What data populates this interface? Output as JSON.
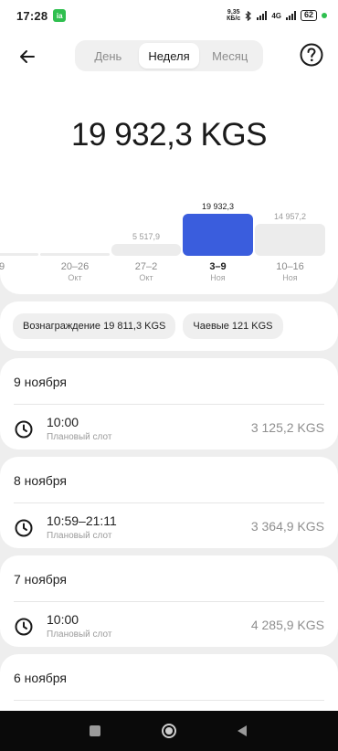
{
  "status_bar": {
    "time": "17:28",
    "app_badge": "ia",
    "speed_top": "9,35",
    "speed_bottom": "КБ/с",
    "network": "4G",
    "battery": "62"
  },
  "header": {
    "tabs": [
      {
        "label": "День",
        "active": false
      },
      {
        "label": "Неделя",
        "active": true
      },
      {
        "label": "Месяц",
        "active": false
      }
    ]
  },
  "total": "19 932,3 KGS",
  "chart_data": {
    "type": "bar",
    "categories": [
      "9",
      "20–26",
      "27–2",
      "3–9",
      "10–16"
    ],
    "sublabels": [
      "",
      "Окт",
      "Окт",
      "Ноя",
      "Ноя"
    ],
    "value_labels": [
      "",
      "",
      "5 517,9",
      "19 932,3",
      "14 957,2"
    ],
    "values": [
      null,
      null,
      5517.9,
      19932.3,
      14957.2
    ],
    "selected_index": 3,
    "colors": {
      "selected": "#3a5ddd",
      "default": "#ececec"
    }
  },
  "chips": [
    {
      "label": "Вознаграждение 19 811,3 KGS"
    },
    {
      "label": "Чаевые 121 KGS"
    }
  ],
  "days": [
    {
      "title": "9 ноября",
      "slot": {
        "time": "10:00",
        "type": "Плановый слот",
        "amount": "3 125,2 KGS"
      }
    },
    {
      "title": "8 ноября",
      "slot": {
        "time": "10:59–21:11",
        "type": "Плановый слот",
        "amount": "3 364,9 KGS"
      }
    },
    {
      "title": "7 ноября",
      "slot": {
        "time": "10:00",
        "type": "Плановый слот",
        "amount": "4 285,9 KGS"
      }
    },
    {
      "title": "6 ноября",
      "slot": {
        "time": "",
        "type": "",
        "amount": ""
      }
    }
  ],
  "icons": {
    "back": "arrow-left-icon",
    "help": "question-circle-icon",
    "slot": "clock-icon",
    "nav": [
      "square-icon",
      "circle-icon",
      "triangle-back-icon"
    ]
  }
}
